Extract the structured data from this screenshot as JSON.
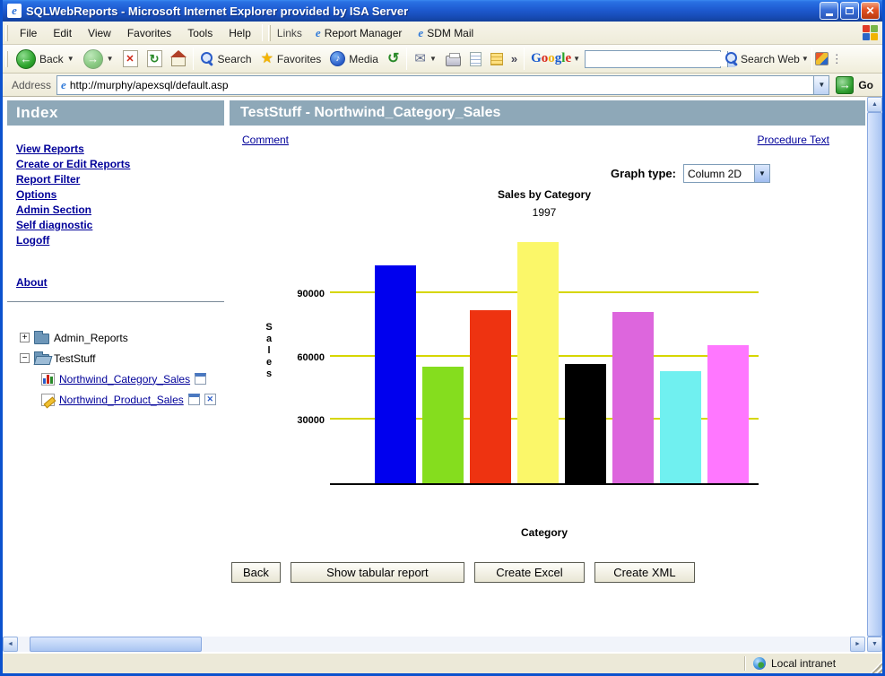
{
  "window": {
    "title": "SQLWebReports - Microsoft Internet Explorer provided by ISA Server"
  },
  "menubar": {
    "items": [
      "File",
      "Edit",
      "View",
      "Favorites",
      "Tools",
      "Help"
    ],
    "links_label": "Links",
    "link_buttons": [
      "Report Manager",
      "SDM Mail"
    ]
  },
  "toolbar": {
    "back": "Back",
    "search": "Search",
    "favorites": "Favorites",
    "media": "Media",
    "google_letters": [
      "G",
      "o",
      "o",
      "g",
      "l",
      "e"
    ],
    "google_letter_colors": [
      "#1a5bce",
      "#d8281c",
      "#eeb211",
      "#1a5bce",
      "#28a428",
      "#d8281c"
    ],
    "google_search_value": "",
    "search_web": "Search Web"
  },
  "addressbar": {
    "label": "Address",
    "url": "http://murphy/apexsql/default.asp",
    "go": "Go"
  },
  "sidebar": {
    "header": "Index",
    "links": [
      "View Reports",
      "Create or Edit Reports",
      "Report Filter",
      "Options",
      "Admin Section",
      "Self diagnostic",
      "Logoff"
    ],
    "about": "About",
    "tree": {
      "node1": "Admin_Reports",
      "node2": "TestStuff",
      "reports": [
        "Northwind_Category_Sales",
        "Northwind_Product_Sales"
      ]
    }
  },
  "main": {
    "header": "TestStuff - Northwind_Category_Sales",
    "comment": "Comment",
    "procedure_text": "Procedure Text",
    "graph_type_label": "Graph type:",
    "graph_type_value": "Column 2D",
    "buttons": [
      "Back",
      "Show tabular report",
      "Create Excel",
      "Create XML"
    ]
  },
  "chart_data": {
    "type": "bar",
    "title": "Sales by Category",
    "subtitle": "1997",
    "ylabel": "Sales",
    "xlabel": "Category",
    "yticks": [
      30000,
      60000,
      90000
    ],
    "ylim": [
      0,
      120000
    ],
    "values": [
      103000,
      55000,
      82000,
      114000,
      56500,
      81000,
      53000,
      65500
    ],
    "colors": [
      "#0000ee",
      "#85dd1e",
      "#ee3311",
      "#fbf769",
      "#000000",
      "#dd66dd",
      "#70f0f0",
      "#ff77ff"
    ],
    "gridline_color": "#d6d600",
    "grid": "horizontal",
    "legend": false
  },
  "statusbar": {
    "zone": "Local intranet"
  }
}
